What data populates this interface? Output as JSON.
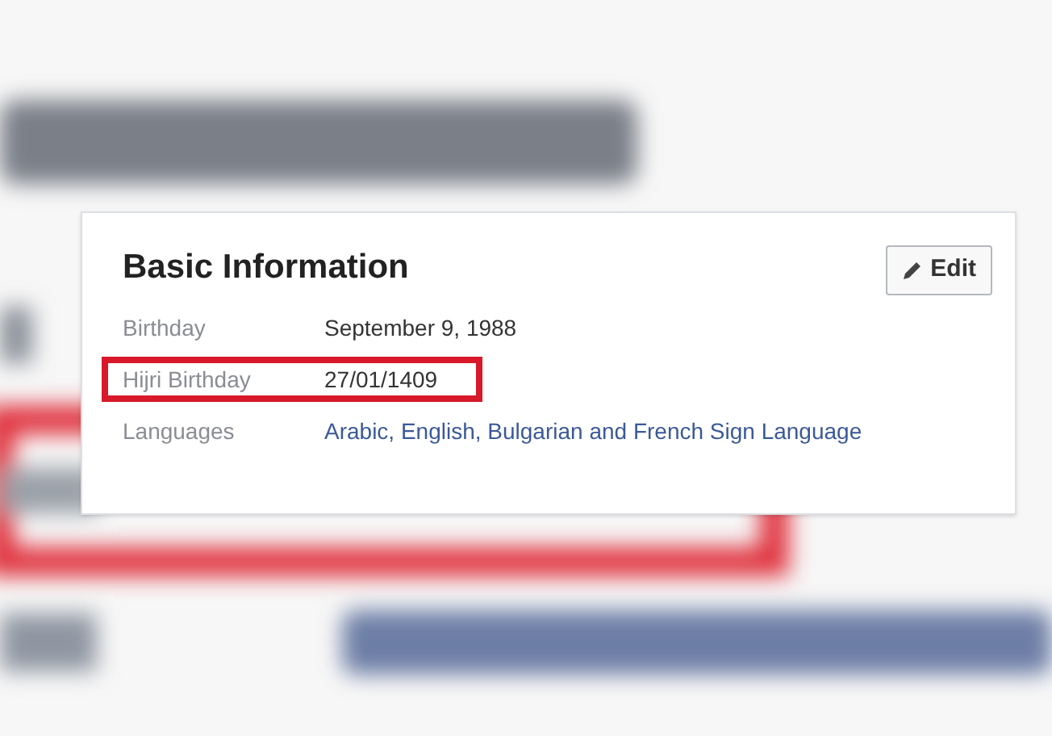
{
  "card": {
    "title": "Basic Information",
    "edit_button": "Edit",
    "rows": [
      {
        "label": "Birthday",
        "value": "September 9, 1988",
        "kind": "plain",
        "highlighted": false
      },
      {
        "label": "Hijri Birthday",
        "value": "27/01/1409",
        "kind": "plain",
        "highlighted": true
      },
      {
        "label": "Languages",
        "value": "Arabic, English, Bulgarian and French Sign Language",
        "kind": "languages",
        "highlighted": false
      }
    ]
  }
}
